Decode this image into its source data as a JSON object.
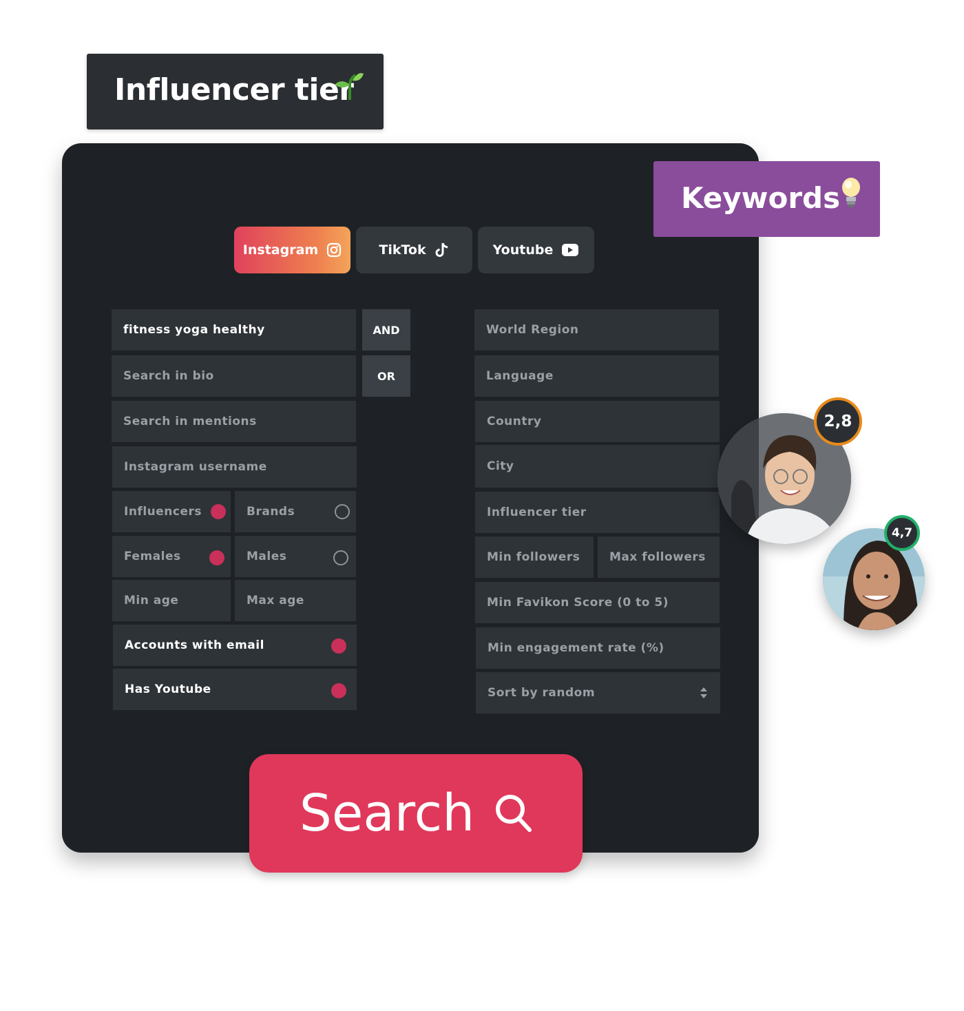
{
  "labels": {
    "influencer_tier": "Influencer tier",
    "keywords": "Keywords"
  },
  "platforms": {
    "instagram": "Instagram",
    "tiktok": "TikTok",
    "youtube": "Youtube"
  },
  "left": {
    "keyword_value": "fitness yoga healthy",
    "logic_and": "AND",
    "logic_or": "OR",
    "search_bio": "Search in bio",
    "search_mentions": "Search in mentions",
    "instagram_username": "Instagram username",
    "influencers": "Influencers",
    "brands": "Brands",
    "females": "Females",
    "males": "Males",
    "min_age": "Min age",
    "max_age": "Max age",
    "accounts_with_email": "Accounts with email",
    "has_youtube": "Has Youtube"
  },
  "right": {
    "world_region": "World Region",
    "language": "Language",
    "country": "Country",
    "city": "City",
    "influencer_tier": "Influencer tier",
    "min_followers": "Min followers",
    "max_followers": "Max followers",
    "min_favikon": "Min Favikon Score (0 to 5)",
    "min_engagement": "Min engagement rate (%)",
    "sort": "Sort by random"
  },
  "toggles": {
    "influencers": true,
    "brands": false,
    "females": true,
    "males": false,
    "accounts_with_email": true,
    "has_youtube": true
  },
  "search": {
    "label": "Search"
  },
  "profiles": [
    {
      "score": "2,8",
      "ring_color": "#e88a1a"
    },
    {
      "score": "4,7",
      "ring_color": "#22b06a"
    }
  ],
  "colors": {
    "panel": "#1e2226",
    "field": "#2e3337",
    "accent_red": "#e0385a",
    "toggle_on": "#c9305a",
    "keywords_purple": "#8a4d9b"
  }
}
